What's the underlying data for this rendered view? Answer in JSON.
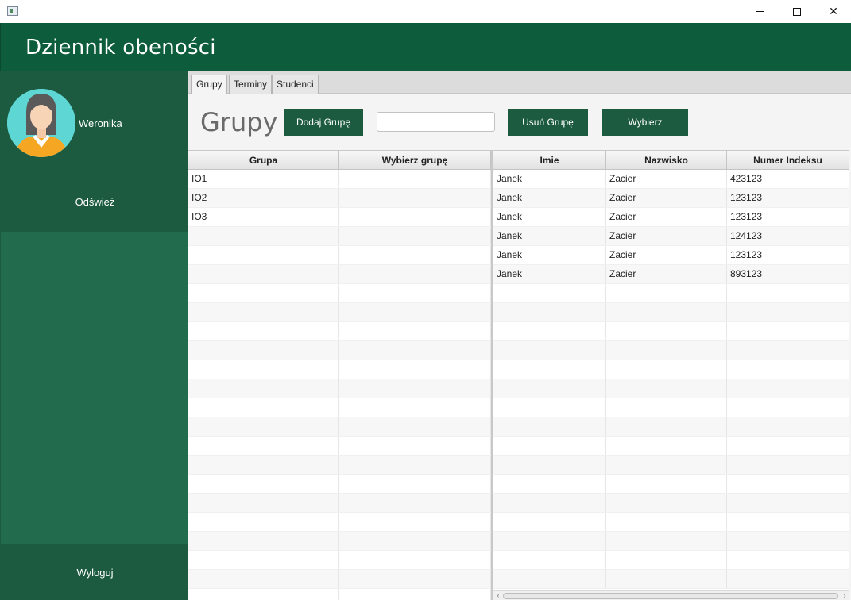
{
  "window": {
    "controls": {
      "minimize": "minimize",
      "maximize": "maximize",
      "close": "close"
    }
  },
  "header": {
    "title": "Dziennik obeności"
  },
  "sidebar": {
    "user_name": "Weronika",
    "refresh_label": "Odśwież",
    "logout_label": "Wyloguj"
  },
  "tabs": [
    {
      "label": "Grupy",
      "active": true
    },
    {
      "label": "Terminy",
      "active": false
    },
    {
      "label": "Studenci",
      "active": false
    }
  ],
  "toolbar": {
    "heading": "Grupy",
    "add_group_label": "Dodaj Grupę",
    "group_input_value": "",
    "remove_group_label": "Usuń Grupę",
    "select_label": "Wybierz"
  },
  "groups_table": {
    "columns": [
      "Grupa",
      "Wybierz grupę"
    ],
    "rows": [
      [
        "IO1",
        ""
      ],
      [
        "IO2",
        ""
      ],
      [
        "IO3",
        ""
      ],
      [
        "",
        ""
      ],
      [
        "",
        ""
      ],
      [
        "",
        ""
      ],
      [
        "",
        ""
      ],
      [
        "",
        ""
      ],
      [
        "",
        ""
      ],
      [
        "",
        ""
      ],
      [
        "",
        ""
      ],
      [
        "",
        ""
      ],
      [
        "",
        ""
      ],
      [
        "",
        ""
      ],
      [
        "",
        ""
      ],
      [
        "",
        ""
      ],
      [
        "",
        ""
      ],
      [
        "",
        ""
      ],
      [
        "",
        ""
      ],
      [
        "",
        ""
      ],
      [
        "",
        ""
      ],
      [
        "",
        ""
      ],
      [
        "",
        ""
      ]
    ]
  },
  "students_table": {
    "columns": [
      "Imie",
      "Nazwisko",
      "Numer Indeksu"
    ],
    "rows": [
      [
        "Janek",
        "Zacier",
        "423123"
      ],
      [
        "Janek",
        "Zacier",
        "123123"
      ],
      [
        "Janek",
        "Zacier",
        "123123"
      ],
      [
        "Janek",
        "Zacier",
        "124123"
      ],
      [
        "Janek",
        "Zacier",
        "123123"
      ],
      [
        "Janek",
        "Zacier",
        "893123"
      ],
      [
        "",
        "",
        ""
      ],
      [
        "",
        "",
        ""
      ],
      [
        "",
        "",
        ""
      ],
      [
        "",
        "",
        ""
      ],
      [
        "",
        "",
        ""
      ],
      [
        "",
        "",
        ""
      ],
      [
        "",
        "",
        ""
      ],
      [
        "",
        "",
        ""
      ],
      [
        "",
        "",
        ""
      ],
      [
        "",
        "",
        ""
      ],
      [
        "",
        "",
        ""
      ],
      [
        "",
        "",
        ""
      ],
      [
        "",
        "",
        ""
      ],
      [
        "",
        "",
        ""
      ],
      [
        "",
        "",
        ""
      ],
      [
        "",
        "",
        ""
      ]
    ]
  },
  "colors": {
    "header": "#0d5c3c",
    "sidebar": "#226b4c",
    "sidebar_dark": "#1c5b40",
    "button": "#1c5b40",
    "avatar_bg": "#5ed7d4"
  }
}
